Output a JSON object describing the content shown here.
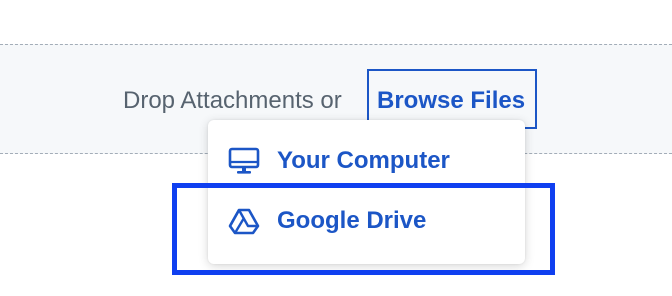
{
  "dropzone": {
    "prompt": "Drop Attachments or",
    "browse_label": "Browse Files"
  },
  "menu": {
    "items": [
      {
        "label": "Your Computer",
        "icon": "monitor-icon"
      },
      {
        "label": "Google Drive",
        "icon": "google-drive-icon"
      }
    ],
    "highlighted": "Google Drive"
  },
  "colors": {
    "accent": "#1c56c6",
    "text_muted": "#57636f",
    "dropzone_bg": "#f6f8fa",
    "dropzone_border": "#a3adb8",
    "focus_ring": "#0f3ff0"
  }
}
